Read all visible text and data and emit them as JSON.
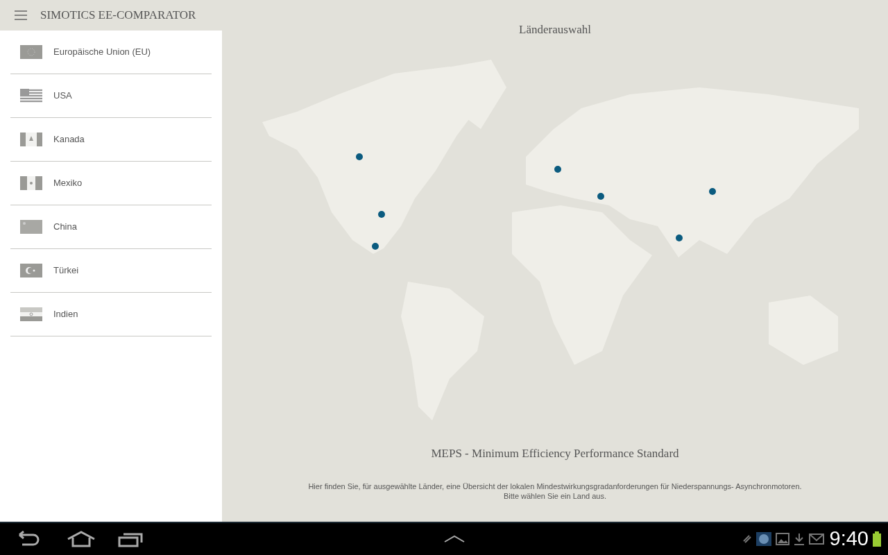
{
  "app_bar": {
    "title": "SIMOTICS EE-COMPARATOR"
  },
  "countries": [
    {
      "label": "Europäische Union (EU)"
    },
    {
      "label": "USA"
    },
    {
      "label": "Kanada"
    },
    {
      "label": "Mexiko"
    },
    {
      "label": "China"
    },
    {
      "label": "Türkei"
    },
    {
      "label": "Indien"
    }
  ],
  "main": {
    "title": "Länderauswahl",
    "heading": "MEPS - Minimum Efficiency Performance Standard",
    "description": [
      "Hier finden Sie, für ausgewählte Länder, eine Übersicht der lokalen Mindestwirkungsgradanforderungen für Niederspannungs- Asynchronmotoren.",
      "Bitte wählen Sie ein Land aus."
    ]
  },
  "status_bar": {
    "time": "9:40"
  }
}
